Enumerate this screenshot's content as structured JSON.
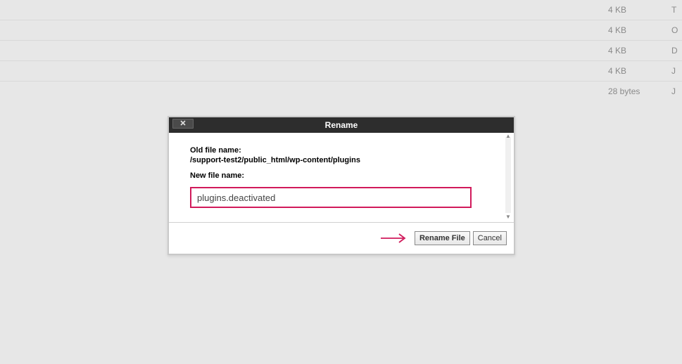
{
  "background_rows": [
    {
      "size": "4 KB",
      "letter": "T"
    },
    {
      "size": "4 KB",
      "letter": "O"
    },
    {
      "size": "4 KB",
      "letter": "D"
    },
    {
      "size": "4 KB",
      "letter": "J"
    },
    {
      "size": "28 bytes",
      "letter": "J"
    }
  ],
  "dialog": {
    "title": "Rename",
    "close_icon": "✕",
    "old_label": "Old file name:",
    "old_path": "/support-test2/public_html/wp-content/plugins",
    "new_label": "New file name:",
    "new_value": "plugins.deactivated",
    "rename_btn": "Rename File",
    "cancel_btn": "Cancel"
  }
}
